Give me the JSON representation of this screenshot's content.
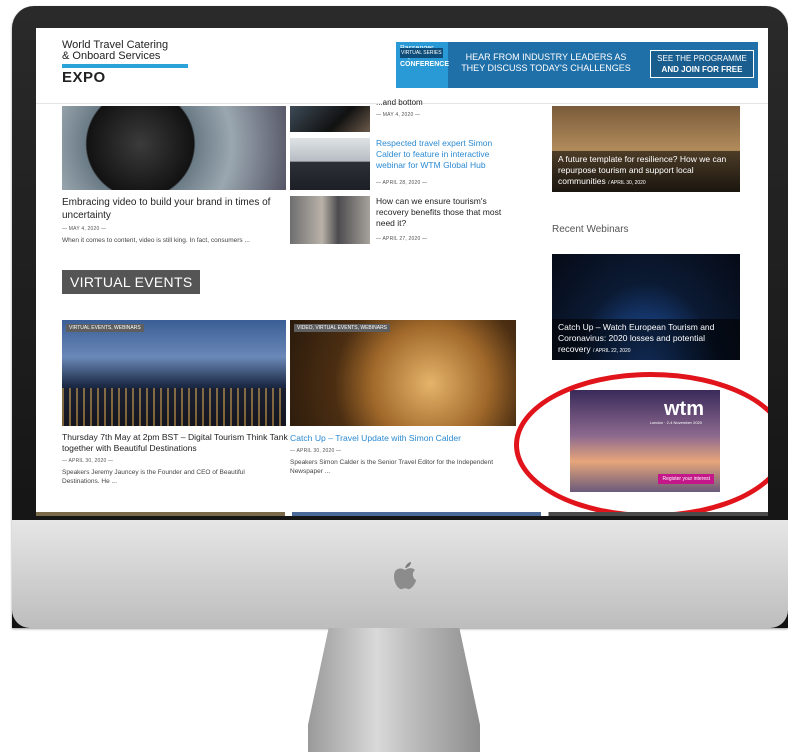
{
  "header": {
    "logo_line1": "World Travel Catering",
    "logo_line2": "& Onboard Services",
    "logo_line3": "EXPO",
    "banner": {
      "brand_line1": "Passenger",
      "brand_line2": "Experience",
      "brand_line3": "CONFERENCE",
      "brand_tag": "VIRTUAL SERIES",
      "message": "HEAR FROM INDUSTRY LEADERS AS THEY DISCUSS TODAY'S CHALLENGES",
      "cta_line1": "SEE THE PROGRAMME",
      "cta_line2": "AND JOIN FOR FREE"
    }
  },
  "left": {
    "post_title": "Embracing video to build your brand in times of uncertainty",
    "post_date": "— MAY 4, 2020 —",
    "post_excerpt": "When it comes to content, video is still king. In fact, consumers ..."
  },
  "middle_list": [
    {
      "title": "...and bottom",
      "date": "— MAY 4, 2020 —"
    },
    {
      "title": "Respected travel expert Simon Calder to feature in interactive webinar for WTM Global Hub",
      "date": "— APRIL 28, 2020 —"
    },
    {
      "title": "How can we ensure tourism's recovery benefits those that most need it?",
      "date": "— APRIL 27, 2020 —"
    }
  ],
  "virtual_events": {
    "section_title": "VIRTUAL EVENTS",
    "cards": [
      {
        "tag": "VIRTUAL EVENTS, WEBINARS",
        "title": "Thursday 7th May at 2pm BST – Digital Tourism Think Tank together with Beautiful Destinations",
        "date": "— APRIL 30, 2020 —",
        "excerpt": "Speakers Jeremy Jauncey is the Founder and CEO of Beautiful Destinations. He ..."
      },
      {
        "tag": "VIDEO, VIRTUAL EVENTS, WEBINARS",
        "title": "Catch Up – Travel Update with Simon Calder",
        "date": "— APRIL 30, 2020 —",
        "excerpt": "Speakers Simon Calder is the Senior Travel Editor for the Independent Newspaper ..."
      }
    ]
  },
  "sidebar": {
    "top_card": {
      "title": "A future template for resilience? How we can repurpose tourism and support local communities",
      "date": "/ APRIL 30, 2020"
    },
    "heading": "Recent Webinars",
    "webinar_card": {
      "title": "Catch Up – Watch European Tourism and Coronavirus: 2020 losses and potential recovery",
      "date": "/ APRIL 22, 2020"
    },
    "ad": {
      "logo": "wtm",
      "sub": "London · 2-4 November 2020",
      "button": "Register your interest"
    }
  },
  "colors": {
    "accent_blue": "#2b8ad2",
    "banner_blue": "#1f6fa8",
    "highlight_red": "#e0141a",
    "wtm_pink": "#c3178a"
  }
}
